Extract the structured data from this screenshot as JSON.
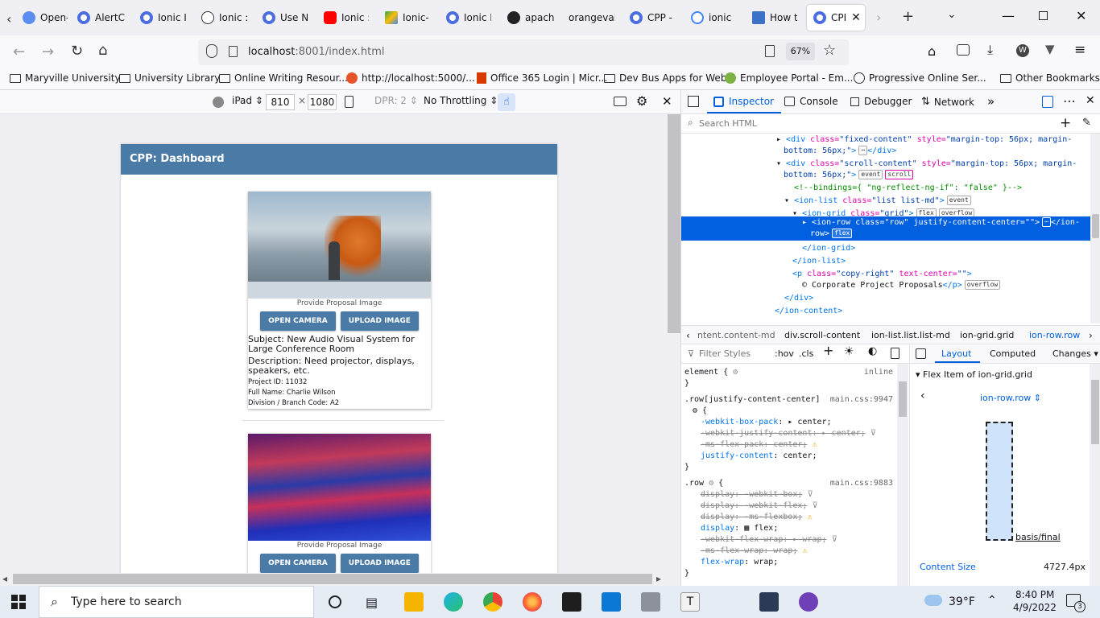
{
  "browser": {
    "tabs": [
      {
        "label": "Open-"
      },
      {
        "label": "AlertC"
      },
      {
        "label": "Ionic I"
      },
      {
        "label": "Ionic :"
      },
      {
        "label": "Use N"
      },
      {
        "label": "Ionic :"
      },
      {
        "label": "Ionic-"
      },
      {
        "label": "Ionic I"
      },
      {
        "label": "apach"
      },
      {
        "label": "orangevall"
      },
      {
        "label": "CPP -"
      },
      {
        "label": "ionic"
      },
      {
        "label": "How t"
      },
      {
        "label": "CPI"
      }
    ],
    "url_host": "localhost",
    "url_rest": ":8001/index.html",
    "zoom": "67%",
    "bookmarks": [
      {
        "label": "Maryville University"
      },
      {
        "label": "University Library"
      },
      {
        "label": "Online Writing Resour..."
      },
      {
        "label": "http://localhost:5000/..."
      },
      {
        "label": "Office 365 Login | Micr..."
      },
      {
        "label": "Dev Bus Apps for Web"
      },
      {
        "label": "Employee Portal - Em..."
      },
      {
        "label": "Progressive Online Ser..."
      }
    ],
    "other_bookmarks": "Other Bookmarks"
  },
  "rdm": {
    "device": "iPad",
    "width": "810",
    "times": "×",
    "height": "1080",
    "dpr": "DPR: 2",
    "throttle": "No Throttling"
  },
  "app": {
    "title": "CPP: Dashboard",
    "cards": [
      {
        "caption": "Provide Proposal Image",
        "open_camera": "OPEN CAMERA",
        "upload_image": "UPLOAD IMAGE",
        "subject": "Subject: New Audio Visual System for Large Conference Room",
        "description": "Description: Need projector, displays, speakers, etc.",
        "project_id": "Project ID: 11032",
        "full_name": "Full Name: Charlie Wilson",
        "division": "Division / Branch Code: A2"
      },
      {
        "caption": "Provide Proposal Image",
        "open_camera": "OPEN CAMERA",
        "upload_image": "UPLOAD IMAGE"
      }
    ]
  },
  "devtools": {
    "tabs": {
      "inspector": "Inspector",
      "console": "Console",
      "debugger": "Debugger",
      "network": "Network"
    },
    "search_placeholder": "Search HTML",
    "breadcrumb": [
      "ntent.content-md",
      "div.scroll-content",
      "ion-list.list.list-md",
      "ion-grid.grid",
      "ion-row.row"
    ],
    "filter_placeholder": "Filter Styles",
    "hov": ":hov",
    "cls": ".cls",
    "layout_tabs": {
      "layout": "Layout",
      "computed": "Computed",
      "changes": "Changes"
    },
    "flex_item_title": "Flex Item of ion-grid.grid",
    "flex_selector": "ion-row.row",
    "basis_label": "basis/final",
    "content_size_label": "Content Size",
    "content_size_value": "4727.4px"
  },
  "taskbar": {
    "search_placeholder": "Type here to search",
    "weather": "39°F",
    "time": "8:40 PM",
    "date": "4/9/2022",
    "notifications": "3"
  }
}
